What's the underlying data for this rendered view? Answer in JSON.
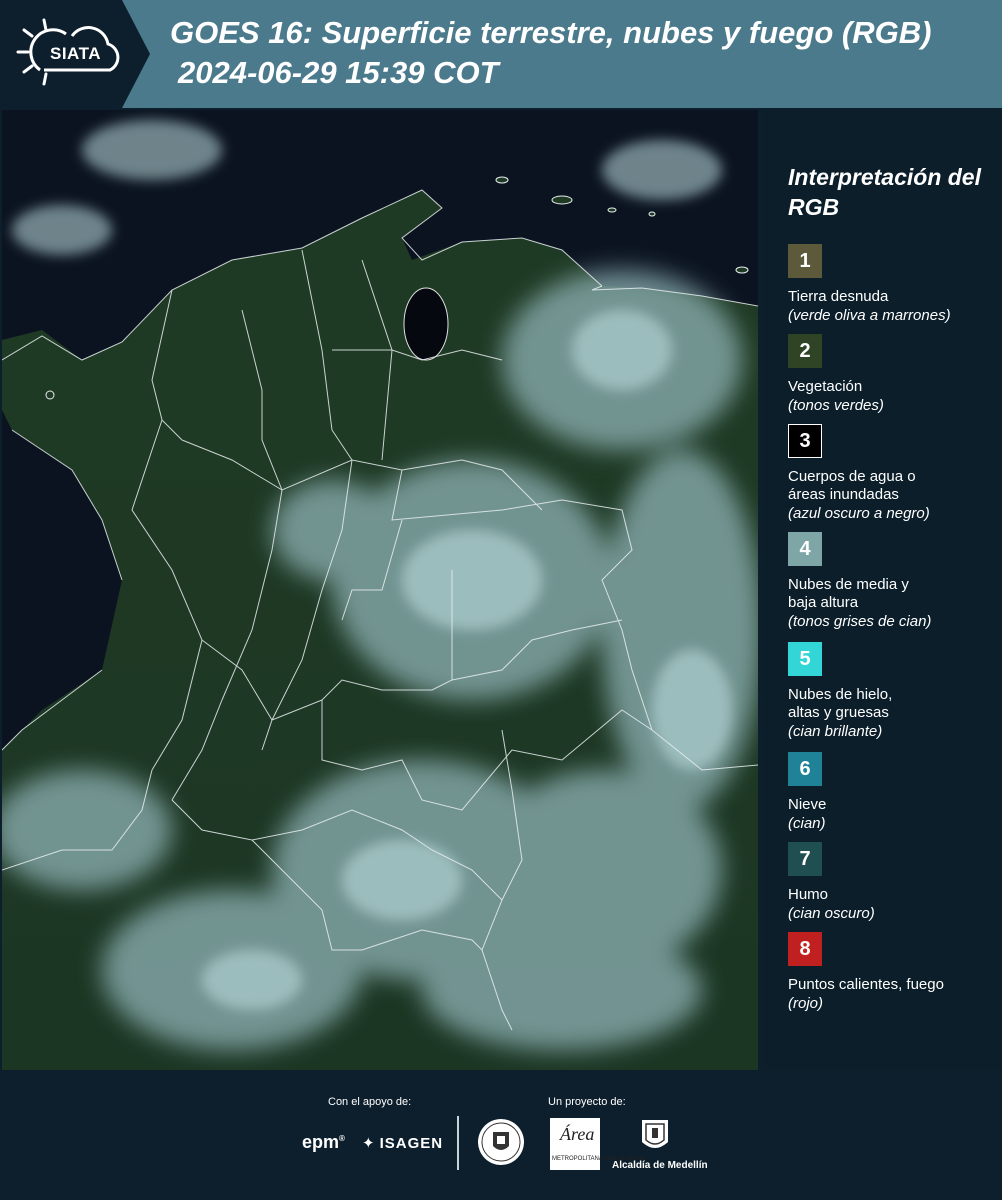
{
  "header": {
    "logo_text": "SIATA",
    "title": "GOES 16: Superficie terrestre, nubes y fuego (RGB)",
    "subtitle": "2024-06-29 15:39 COT",
    "background_color": "#4a7a8c"
  },
  "legend": {
    "title": "Interpretación del RGB",
    "items": [
      {
        "number": "1",
        "label": "Tierra desnuda",
        "desc": "(verde oliva a marrones)",
        "color": "#5c5a3a"
      },
      {
        "number": "2",
        "label": "Vegetación",
        "desc": "(tonos verdes)",
        "color": "#2f4424"
      },
      {
        "number": "3",
        "label": "Cuerpos de agua o áreas inundadas",
        "desc": "(azul oscuro a negro)",
        "color": "#000000"
      },
      {
        "number": "4",
        "label": "Nubes de media y baja altura",
        "desc": "(tonos grises de cian)",
        "color": "#7fa6a6"
      },
      {
        "number": "5",
        "label": "Nubes de hielo, altas y gruesas",
        "desc": "(cian brillante)",
        "color": "#33d6d6"
      },
      {
        "number": "6",
        "label": "Nieve",
        "desc": "(cian)",
        "color": "#1f8296"
      },
      {
        "number": "7",
        "label": "Humo",
        "desc": "(cian oscuro)",
        "color": "#1f4f50"
      },
      {
        "number": "8",
        "label": "Puntos calientes, fuego",
        "desc": "(rojo)",
        "color": "#c0201f"
      }
    ]
  },
  "footer": {
    "support_label": "Con el apoyo de:",
    "project_label": "Un proyecto de:",
    "epm": "epm",
    "isagen": "ISAGEN",
    "amva_main": "Área",
    "amva_sub": "METROPOLITANA Valle de Aburrá",
    "alcaldia": "Alcaldía de Medellín"
  }
}
